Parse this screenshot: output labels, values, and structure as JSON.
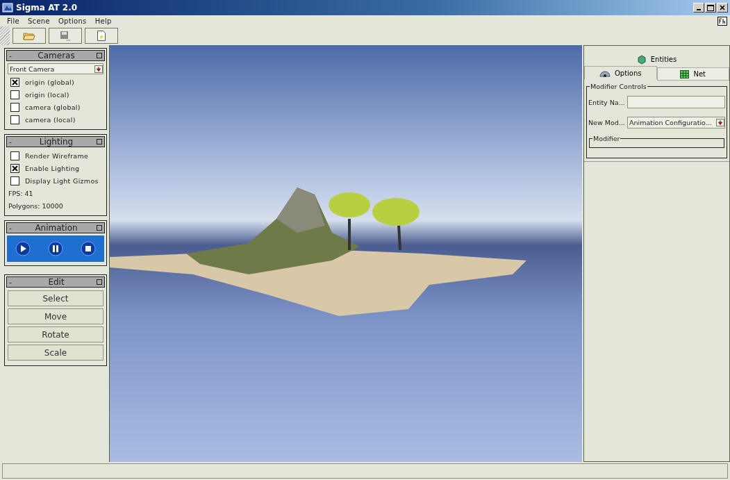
{
  "window": {
    "title": "Sigma AT 2.0"
  },
  "menu": [
    "File",
    "Scene",
    "Options",
    "Help"
  ],
  "cameras": {
    "title": "Cameras",
    "collapse": "-",
    "dropdown": "Front Camera",
    "options": [
      {
        "label": "origin (global)",
        "checked": true
      },
      {
        "label": "origin (local)",
        "checked": false
      },
      {
        "label": "camera (global)",
        "checked": false
      },
      {
        "label": "camera (local)",
        "checked": false
      }
    ]
  },
  "lighting": {
    "title": "Lighting",
    "collapse": "-",
    "options": [
      {
        "label": "Render Wireframe",
        "checked": false
      },
      {
        "label": "Enable Lighting",
        "checked": true
      },
      {
        "label": "Display Light Gizmos",
        "checked": false
      }
    ],
    "stats": [
      "FPS: 41",
      "Polygons: 10000"
    ]
  },
  "animation": {
    "title": "Animation",
    "collapse": "-"
  },
  "edit": {
    "title": "Edit",
    "collapse": "-",
    "buttons": [
      "Select",
      "Move",
      "Rotate",
      "Scale"
    ]
  },
  "tabs_top": [
    {
      "label": "Entities",
      "selected": false
    }
  ],
  "tabs": [
    {
      "label": "Options",
      "selected": true
    },
    {
      "label": "Net",
      "selected": false
    }
  ],
  "modifier_controls": {
    "title": "Modifier Controls",
    "entity_name_label": "Entity Na...",
    "new_modifier_label": "New Mod...",
    "new_modifier_value": "Animation Configuratio...",
    "modifier_group": "Modifier"
  }
}
